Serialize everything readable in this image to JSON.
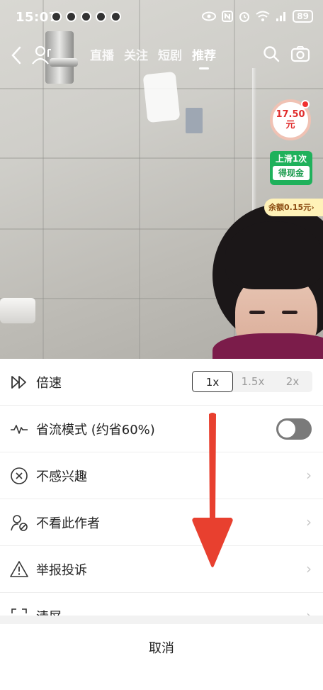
{
  "status_bar": {
    "time": "15:07",
    "battery": "89",
    "icons": [
      "eye-icon",
      "nfc-icon",
      "alarm-icon",
      "wifi-icon",
      "signal-icon",
      "battery-icon"
    ]
  },
  "top_nav": {
    "tabs": [
      {
        "label": "直播",
        "active": false
      },
      {
        "label": "关注",
        "active": false
      },
      {
        "label": "短剧",
        "active": false
      },
      {
        "label": "推荐",
        "active": true
      }
    ]
  },
  "rewards": {
    "coin_amount": "17.50",
    "coin_unit": "元",
    "slide_line1": "上滑1次",
    "slide_line2": "得现金",
    "balance": "余额0.15元",
    "balance_chevron": "›"
  },
  "sheet": {
    "speed": {
      "label": "倍速",
      "options": [
        "1x",
        "1.5x",
        "2x"
      ],
      "selected": "1x"
    },
    "data_saver": {
      "label": "省流模式 (约省60%)",
      "enabled": false
    },
    "not_interested": {
      "label": "不感兴趣"
    },
    "hide_author": {
      "label": "不看此作者"
    },
    "report": {
      "label": "举报投诉"
    },
    "clear_screen": {
      "label": "清屏"
    },
    "chevron": "›",
    "cancel": "取消"
  },
  "colors": {
    "accent_red": "#e02d2d",
    "badge_green": "#1fb15b",
    "arrow_red": "#e8402f"
  }
}
